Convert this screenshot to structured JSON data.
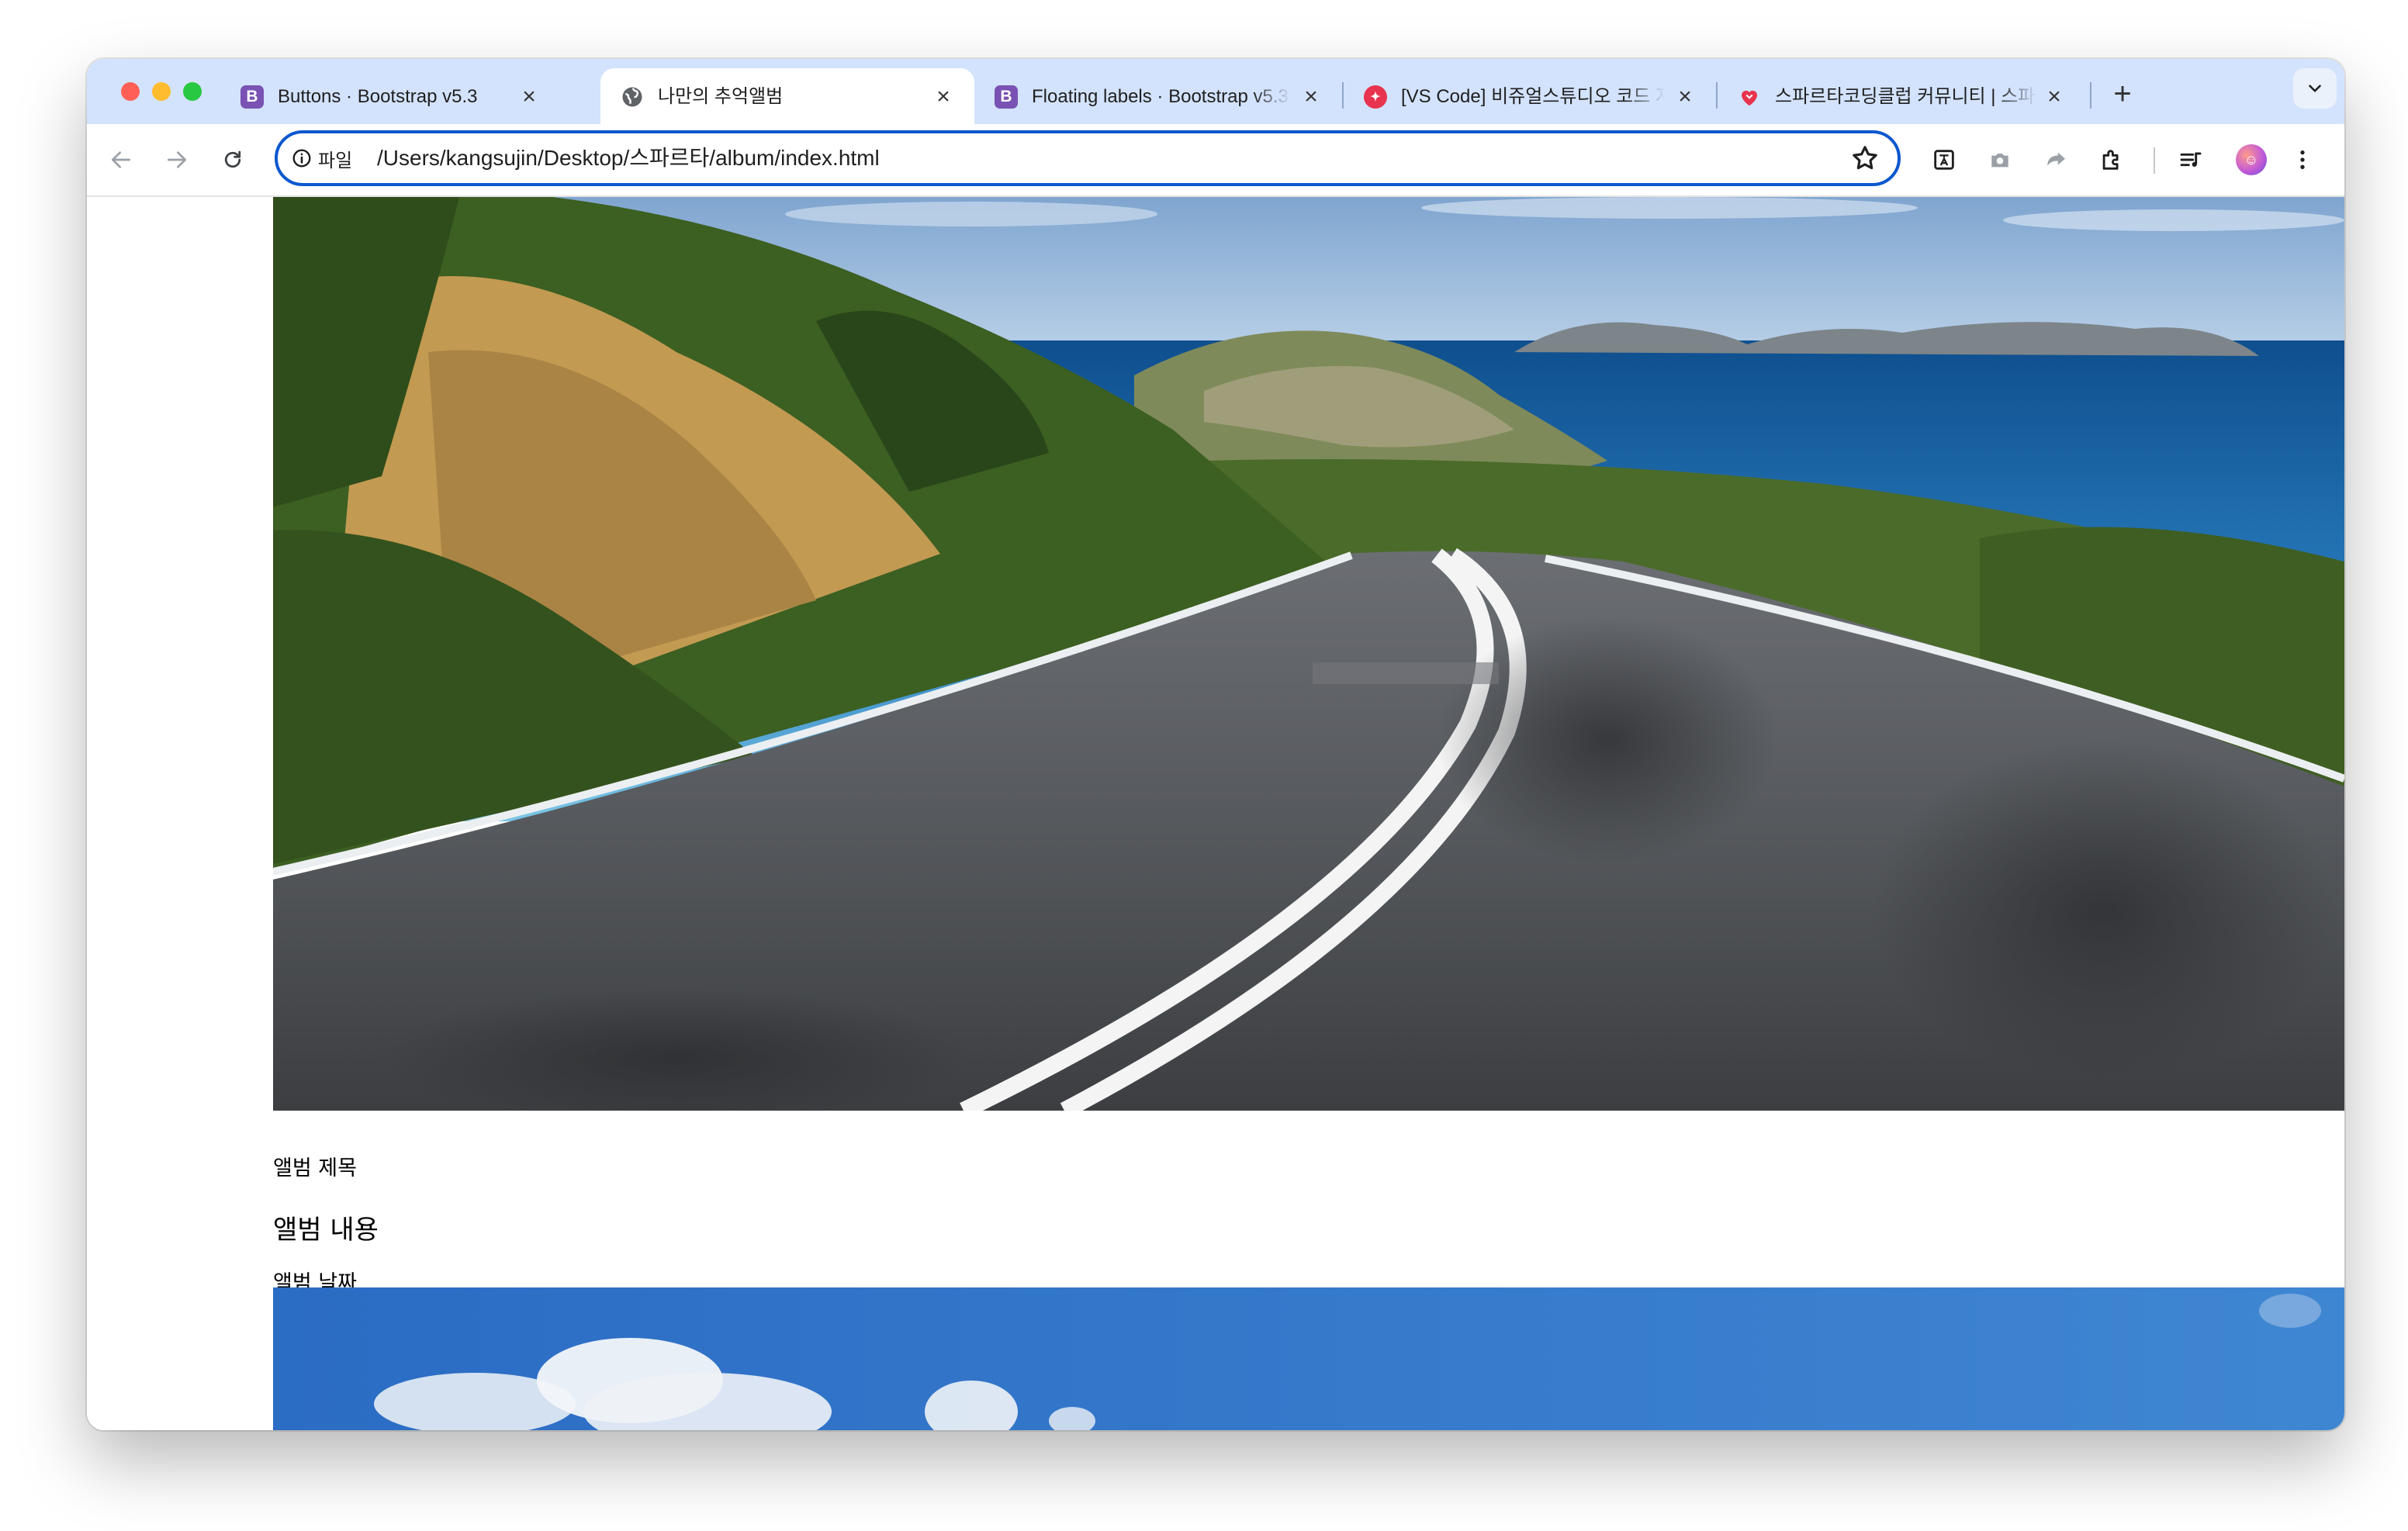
{
  "browser": {
    "window_controls": {
      "close_color": "#ff5f57",
      "minimize_color": "#febc2e",
      "maximize_color": "#28c840"
    },
    "tabs": [
      {
        "title": "Buttons · Bootstrap v5.3",
        "icon": "bootstrap-icon",
        "icon_letter": "B",
        "icon_color": "#7952b3",
        "active": false
      },
      {
        "title": "나만의 추억앨범",
        "icon": "globe-icon",
        "active": true
      },
      {
        "title": "Floating labels · Bootstrap v5.3",
        "icon": "bootstrap-icon",
        "icon_letter": "B",
        "icon_color": "#7952b3",
        "active": false
      },
      {
        "title": "[VS Code] 비쥬얼스튜디오 코드 자동",
        "icon": "sparta-icon",
        "icon_color": "#e8344e",
        "active": false
      },
      {
        "title": "스파르타코딩클럽 커뮤니티 | 스파르타",
        "icon": "heart-icon",
        "icon_color": "#e8344e",
        "active": false
      }
    ],
    "address_bar": {
      "scheme_label": "파일",
      "url": "/Users/kangsujin/Desktop/스파르타/album/index.html"
    },
    "toolbar_icons": [
      "back-icon",
      "forward-icon",
      "reload-icon",
      "info-icon",
      "bookmark-star-icon",
      "translate-icon",
      "camera-icon",
      "share-icon",
      "extensions-icon",
      "reading-list-icon",
      "profile-avatar-icon",
      "more-menu-icon"
    ],
    "accent_color": "#0b57d0",
    "tabstrip_color": "#d3e3fd"
  },
  "page": {
    "album_title": "앨범 제목",
    "album_content": "앨범 내용",
    "album_date": "앨범 날짜"
  }
}
